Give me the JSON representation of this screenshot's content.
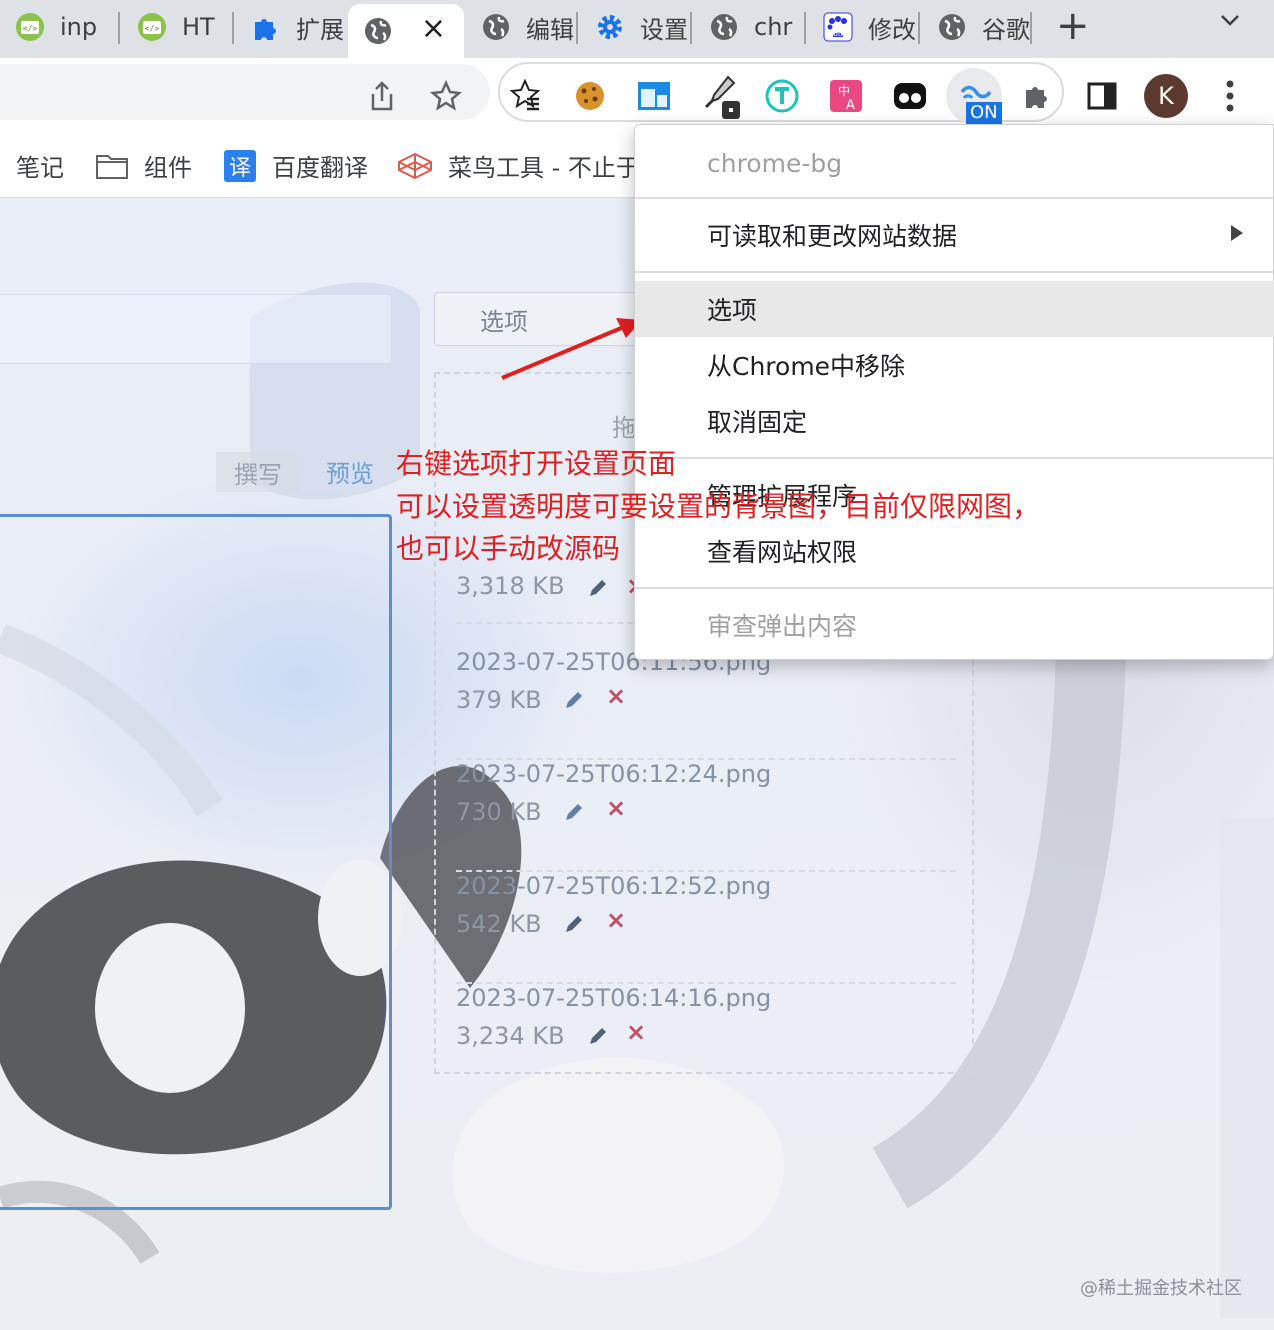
{
  "tabs": [
    {
      "label": "inp",
      "icon": "html-file-icon"
    },
    {
      "label": "HT",
      "icon": "html-file-icon"
    },
    {
      "label": "扩展",
      "icon": "puzzle-icon"
    },
    {
      "label": "",
      "icon": "globe-icon",
      "active": true
    },
    {
      "label": "编辑",
      "icon": "globe-icon"
    },
    {
      "label": "设置",
      "icon": "gear-icon"
    },
    {
      "label": "chr",
      "icon": "globe-icon"
    },
    {
      "label": "修改",
      "icon": "baidu-icon"
    },
    {
      "label": "谷歌",
      "icon": "globe-icon"
    }
  ],
  "toolbar": {
    "extensions": [
      "star-list-icon",
      "cookie-icon",
      "window-icon",
      "eyedropper-icon",
      "translate-t-icon",
      "translate-zh-icon",
      "mask-icon",
      "chrome-bg-icon",
      "puzzle-icon"
    ],
    "ext_badge": "ON",
    "avatar_initial": "K"
  },
  "bookmarks": [
    {
      "label": "笔记",
      "icon": ""
    },
    {
      "label": "组件",
      "icon": "folder-icon"
    },
    {
      "label": "百度翻译",
      "icon": "translate-icon",
      "icon_text": "译"
    },
    {
      "label": "菜鸟工具 - 不止于",
      "icon": "codepen-icon"
    }
  ],
  "page": {
    "options_button": "选项",
    "drag_hint": "拖",
    "tab_write": "撰写",
    "tab_preview": "预览",
    "files": [
      {
        "name": "",
        "size": "3,318 KB"
      },
      {
        "name": "2023-07-25T06:11:56.png",
        "size": "379 KB"
      },
      {
        "name": "2023-07-25T06:12:24.png",
        "size": "730 KB"
      },
      {
        "name": "2023-07-25T06:12:52.png",
        "size": "542 KB"
      },
      {
        "name": "2023-07-25T06:14:16.png",
        "size": "3,234 KB"
      }
    ],
    "delete_glyph": "×"
  },
  "annotation": {
    "line1": "右键选项打开设置页面",
    "line2": "可以设置透明度可要设置的背景图，目前仅限网图，",
    "line3": "也可以手动改源码",
    "color": "#e02020"
  },
  "context_menu": {
    "header": "chrome-bg",
    "items": [
      {
        "label": "可读取和更改网站数据",
        "submenu": true
      },
      {
        "label": "选项",
        "hover": true
      },
      {
        "label": "从Chrome中移除"
      },
      {
        "label": "取消固定"
      },
      {
        "label": "管理扩展程序"
      },
      {
        "label": "查看网站权限"
      },
      {
        "label": "审查弹出内容",
        "disabled": true
      }
    ]
  },
  "watermark": "@稀土掘金技术社区"
}
